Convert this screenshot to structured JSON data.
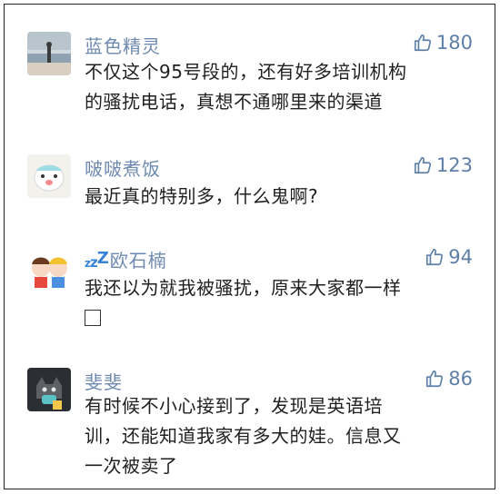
{
  "comments": [
    {
      "name": "蓝色精灵",
      "likes": "180",
      "text_lines": [
        "不仅这个95号段的，还有好多培训机构",
        "的骚扰电话，真想不通哪里来的渠道"
      ]
    },
    {
      "name": "啵啵煮饭",
      "likes": "123",
      "text_lines": [
        "最近真的特别多，什么鬼啊?"
      ]
    },
    {
      "name": "欧石楠",
      "name_prefix_icon": "zzz-sleep-emoji",
      "likes": "94",
      "text_lines": [
        "我还以为就我被骚扰，原来大家都一样"
      ],
      "trailing_icon": "missing-emoji-box"
    },
    {
      "name": "斐斐",
      "likes": "86",
      "text_lines": [
        "有时候不小心接到了，发现是英语培",
        "训，还能知道我家有多大的娃。信息又",
        "一次被卖了"
      ]
    }
  ],
  "icons": {
    "like": "thumbs-up-icon"
  },
  "colors": {
    "name": "#6f8ab0",
    "like": "#5d7fa8",
    "text": "#1f1f1f"
  }
}
